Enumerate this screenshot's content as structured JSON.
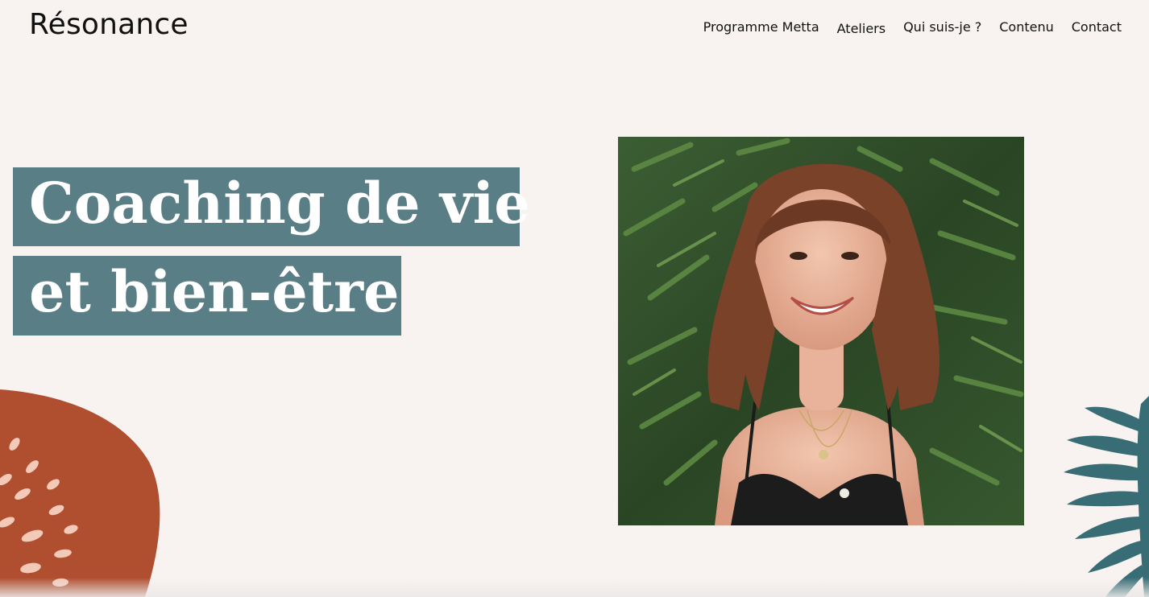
{
  "site": {
    "logo": "Résonance"
  },
  "nav": {
    "items": [
      {
        "label": "Programme Metta"
      },
      {
        "label": "Ateliers"
      },
      {
        "label": "Qui suis-je ?"
      },
      {
        "label": "Contenu"
      },
      {
        "label": "Contact"
      }
    ]
  },
  "hero": {
    "line1": "Coaching de vie",
    "line2": "et bien-être"
  },
  "colors": {
    "background": "#f8f3f1",
    "hero_band": "#5a7e85",
    "blob": "#b04e30",
    "leaf": "#2e6670"
  },
  "icons": [
    "portrait-photo",
    "terracotta-blob-decoration",
    "palm-leaf-decoration"
  ]
}
